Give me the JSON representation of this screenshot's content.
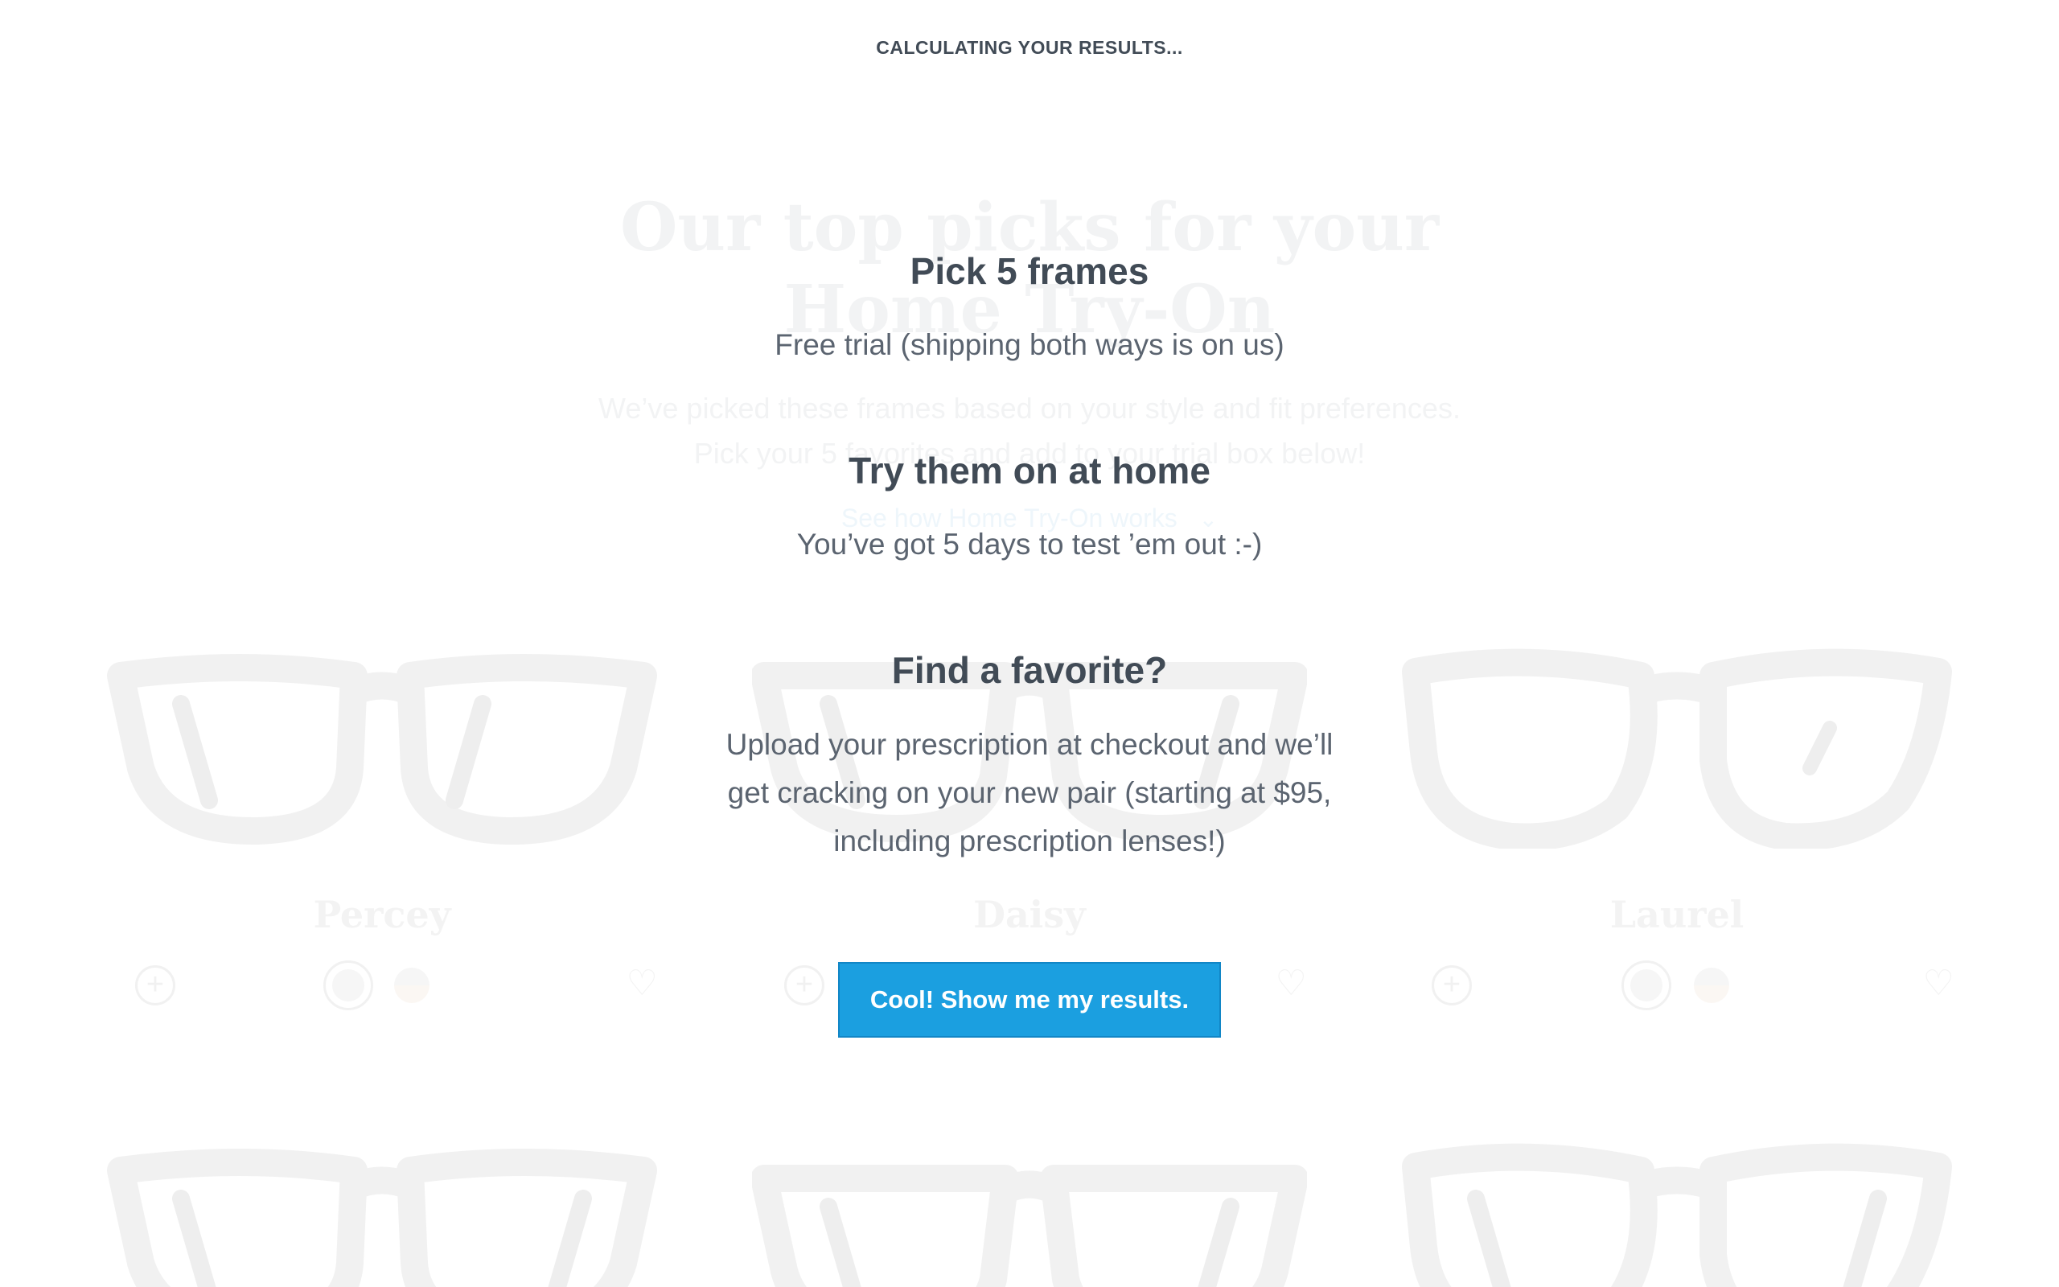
{
  "status_heading": "CALCULATING YOUR RESULTS...",
  "background": {
    "title_line1": "Our top picks for your",
    "title_line2": "Home Try-On",
    "subtitle_line1": "We’ve picked these frames based on your style and fit preferences.",
    "subtitle_line2": "Pick your 5 favorites and add to your trial box below!",
    "how_link": "See how Home Try-On works",
    "products": [
      {
        "name": "Percey"
      },
      {
        "name": "Daisy"
      },
      {
        "name": "Laurel"
      }
    ]
  },
  "steps": [
    {
      "title": "Pick 5 frames",
      "text": "Free trial (shipping both ways is on us)"
    },
    {
      "title": "Try them on at home",
      "text": "You’ve got 5 days to test ’em out :-)"
    },
    {
      "title": "Find a favorite?",
      "text_lines": [
        "Upload your prescription at checkout and we’ll",
        "get cracking on your new pair (starting at $95,",
        "including prescription lenses!)"
      ]
    }
  ],
  "cta_label": "Cool! Show me my results.",
  "colors": {
    "accent": "#1b9fe0",
    "heading": "#414b56",
    "body_text": "#5b6470",
    "faded": "#f2f3f4"
  },
  "icons": {
    "add": "plus-icon",
    "favorite": "heart-icon",
    "expand": "chevron-down-icon"
  }
}
